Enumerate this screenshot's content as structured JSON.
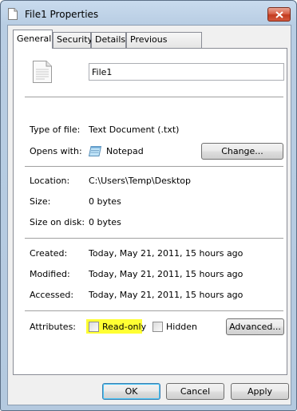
{
  "window": {
    "title": "File1 Properties",
    "close_icon": "close-x-icon",
    "title_icon": "document-icon"
  },
  "tabs": [
    {
      "label": "General",
      "active": true
    },
    {
      "label": "Security",
      "active": false
    },
    {
      "label": "Details",
      "active": false
    },
    {
      "label": "Previous Versions",
      "active": false
    }
  ],
  "general": {
    "file_name": "File1",
    "type_label": "Type of file:",
    "type_value": "Text Document (.txt)",
    "opens_label": "Opens with:",
    "opens_value": "Notepad",
    "change_button": "Change...",
    "location_label": "Location:",
    "location_value": "C:\\Users\\Temp\\Desktop",
    "size_label": "Size:",
    "size_value": "0 bytes",
    "size_on_disk_label": "Size on disk:",
    "size_on_disk_value": "0 bytes",
    "created_label": "Created:",
    "created_value": "Today, May 21, 2011, 15 hours ago",
    "modified_label": "Modified:",
    "modified_value": "Today, May 21, 2011, 15 hours ago",
    "accessed_label": "Accessed:",
    "accessed_value": "Today, May 21, 2011, 15 hours ago",
    "attributes_label": "Attributes:",
    "readonly_label": "Read-only",
    "readonly_checked": false,
    "hidden_label": "Hidden",
    "hidden_checked": false,
    "advanced_button": "Advanced..."
  },
  "footer": {
    "ok": "OK",
    "cancel": "Cancel",
    "apply": "Apply"
  },
  "colors": {
    "highlight": "#ffff33",
    "title_gradient": "#b8cde3",
    "close_button": "#c23b1f"
  }
}
